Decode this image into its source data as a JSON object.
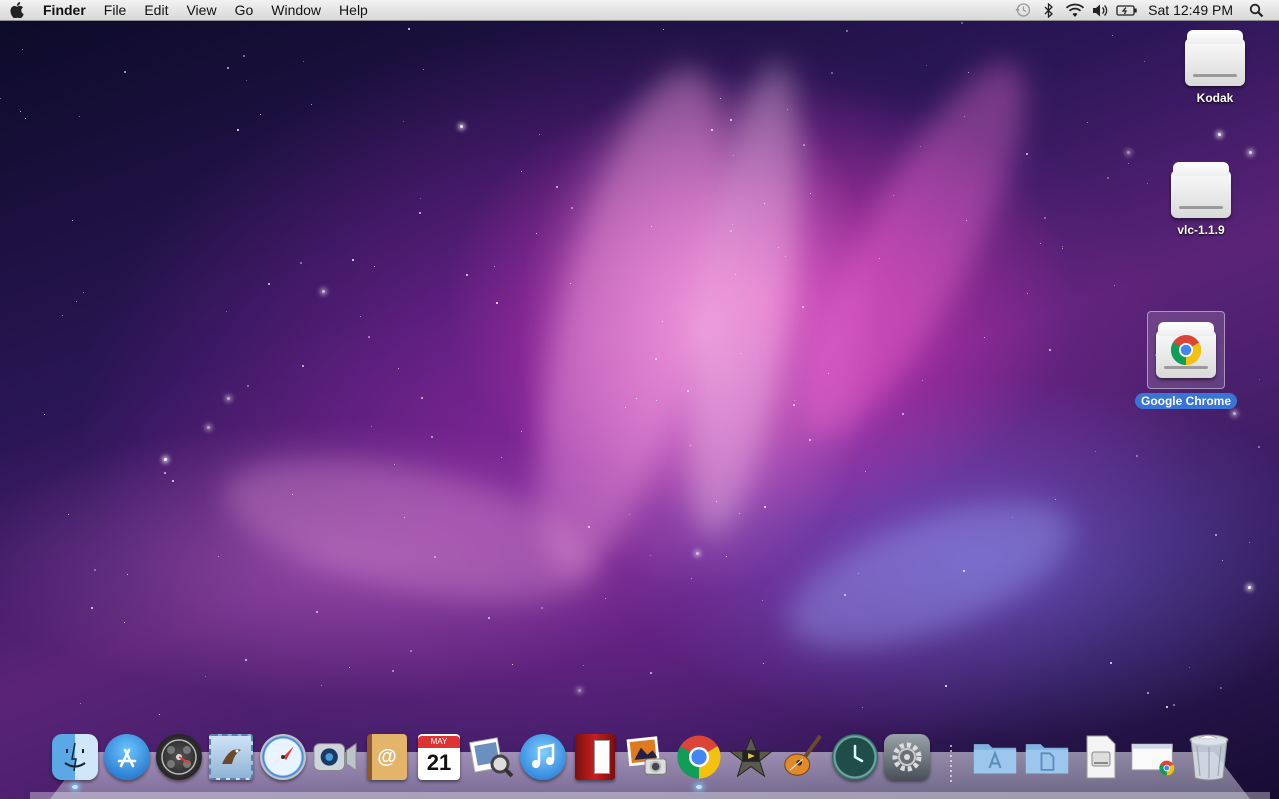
{
  "menubar": {
    "apple_icon": "apple-icon",
    "app_name": "Finder",
    "menus": [
      "File",
      "Edit",
      "View",
      "Go",
      "Window",
      "Help"
    ],
    "status_icons": [
      "time-machine-icon",
      "bluetooth-icon",
      "wifi-icon",
      "volume-icon",
      "battery-icon"
    ],
    "clock": "Sat 12:49 PM",
    "spotlight_icon": "spotlight-search-icon"
  },
  "desktop": {
    "icons": [
      {
        "label": "Kodak",
        "icon": "external-drive-icon",
        "selected": false
      },
      {
        "label": "vlc-1.1.9",
        "icon": "external-drive-icon",
        "selected": false
      },
      {
        "label": "Google Chrome",
        "icon": "chrome-drive-icon",
        "selected": true
      }
    ]
  },
  "dock": {
    "apps": [
      {
        "name": "finder",
        "icon": "finder-icon",
        "running": true
      },
      {
        "name": "app-store",
        "icon": "app-store-icon",
        "running": false
      },
      {
        "name": "dashboard",
        "icon": "dashboard-icon",
        "running": false
      },
      {
        "name": "mail",
        "icon": "mail-icon",
        "running": false
      },
      {
        "name": "safari",
        "icon": "safari-icon",
        "running": false
      },
      {
        "name": "facetime",
        "icon": "facetime-icon",
        "running": false
      },
      {
        "name": "address-book",
        "icon": "address-book-icon",
        "running": false
      },
      {
        "name": "ical",
        "icon": "calendar-icon",
        "running": false,
        "month": "MAY",
        "day": "21"
      },
      {
        "name": "preview",
        "icon": "preview-icon",
        "running": false
      },
      {
        "name": "itunes",
        "icon": "itunes-icon",
        "running": false
      },
      {
        "name": "photo-booth",
        "icon": "photo-booth-icon",
        "running": false
      },
      {
        "name": "iphoto",
        "icon": "iphoto-icon",
        "running": false
      },
      {
        "name": "google-chrome",
        "icon": "chrome-icon",
        "running": true
      },
      {
        "name": "imovie",
        "icon": "imovie-icon",
        "running": false
      },
      {
        "name": "garageband",
        "icon": "garageband-icon",
        "running": false
      },
      {
        "name": "time-machine",
        "icon": "time-machine-icon",
        "running": false
      },
      {
        "name": "system-preferences",
        "icon": "system-preferences-icon",
        "running": false
      }
    ],
    "stacks": [
      {
        "name": "applications",
        "icon": "applications-folder-icon"
      },
      {
        "name": "documents",
        "icon": "documents-folder-icon"
      },
      {
        "name": "downloads",
        "icon": "downloads-stack-icon"
      },
      {
        "name": "chrome-installer",
        "icon": "chrome-installer-icon"
      },
      {
        "name": "trash",
        "icon": "trash-icon"
      }
    ]
  },
  "colors": {
    "selection_blue": "#3875d7",
    "menubar_bg": "#e6e6e6"
  }
}
